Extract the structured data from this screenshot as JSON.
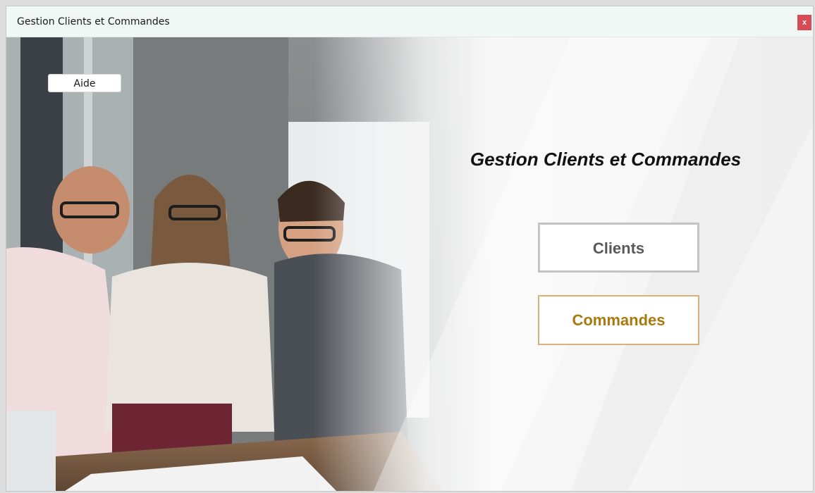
{
  "window": {
    "title": "Gestion Clients et Commandes",
    "close_label": "x"
  },
  "toolbar": {
    "help_label": "Aide"
  },
  "main": {
    "heading": "Gestion Clients et Commandes",
    "clients_label": "Clients",
    "orders_label": "Commandes"
  },
  "colors": {
    "titlebar_bg": "#f1f7f5",
    "close_bg": "#d84a55",
    "clients_border": "#c3c3c3",
    "clients_text": "#595959",
    "orders_border": "#d4b27a",
    "orders_text": "#a8790f"
  },
  "icons": {
    "close": "close-icon"
  }
}
